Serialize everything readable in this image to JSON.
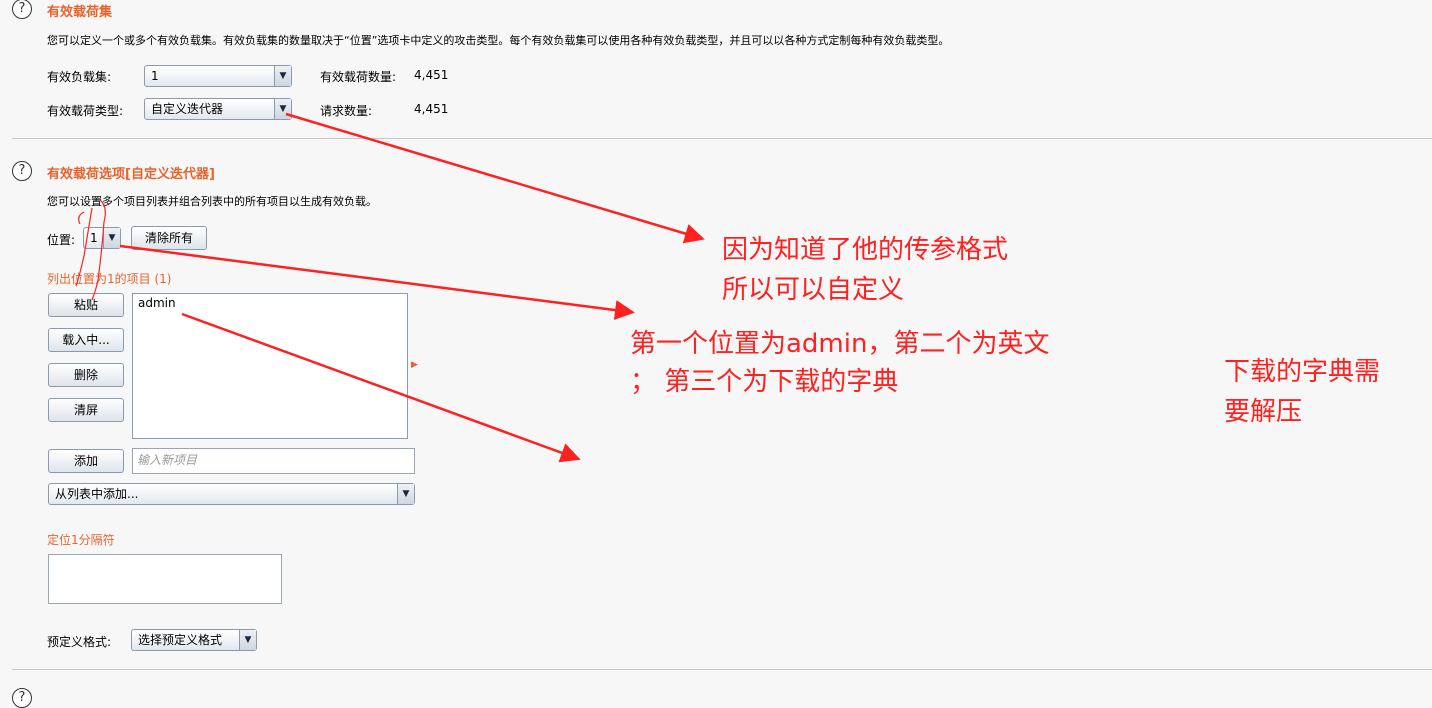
{
  "section1": {
    "title": "有效载荷集",
    "desc": "您可以定义一个或多个有效负载集。有效负载集的数量取决于“位置”选项卡中定义的攻击类型。每个有效负载集可以使用各种有效负载类型，并且可以以各种方式定制每种有效负载类型。",
    "payload_set_label": "有效负载集:",
    "payload_set_value": "1",
    "payload_count_label": "有效载荷数量:",
    "payload_count_value": "4,451",
    "payload_type_label": "有效载荷类型:",
    "payload_type_value": "自定义迭代器",
    "request_count_label": "请求数量:",
    "request_count_value": "4,451"
  },
  "section2": {
    "title": "有效载荷选项[自定义迭代器]",
    "desc": "您可以设置多个项目列表并组合列表中的所有项目以生成有效负载。",
    "position_label": "位置:",
    "position_value": "1",
    "clear_all_label": "清除所有",
    "list_label": "列出位置为1的项目 (1)",
    "buttons": {
      "paste": "粘贴",
      "load": "载入中...",
      "remove": "删除",
      "clear": "清屏",
      "add": "添加"
    },
    "items": [
      "admin"
    ],
    "add_placeholder": "输入新项目",
    "add_from_list": "从列表中添加...",
    "separator_label": "定位1分隔符",
    "predefined_label": "预定义格式:",
    "predefined_value": "选择预定义格式"
  },
  "annotations": {
    "note1_line1": "因为知道了他的传参格式",
    "note1_line2": "所以可以自定义",
    "note2_line1": "第一个位置为admin，第二个为英文",
    "note2_line2": "；  第三个为下载的字典",
    "note3_line1": "下载的字典需",
    "note3_line2": "要解压",
    "color": "#ff2020"
  },
  "icons": {
    "help": "?",
    "dropdown": "▼",
    "expand_arrow": "▶"
  }
}
